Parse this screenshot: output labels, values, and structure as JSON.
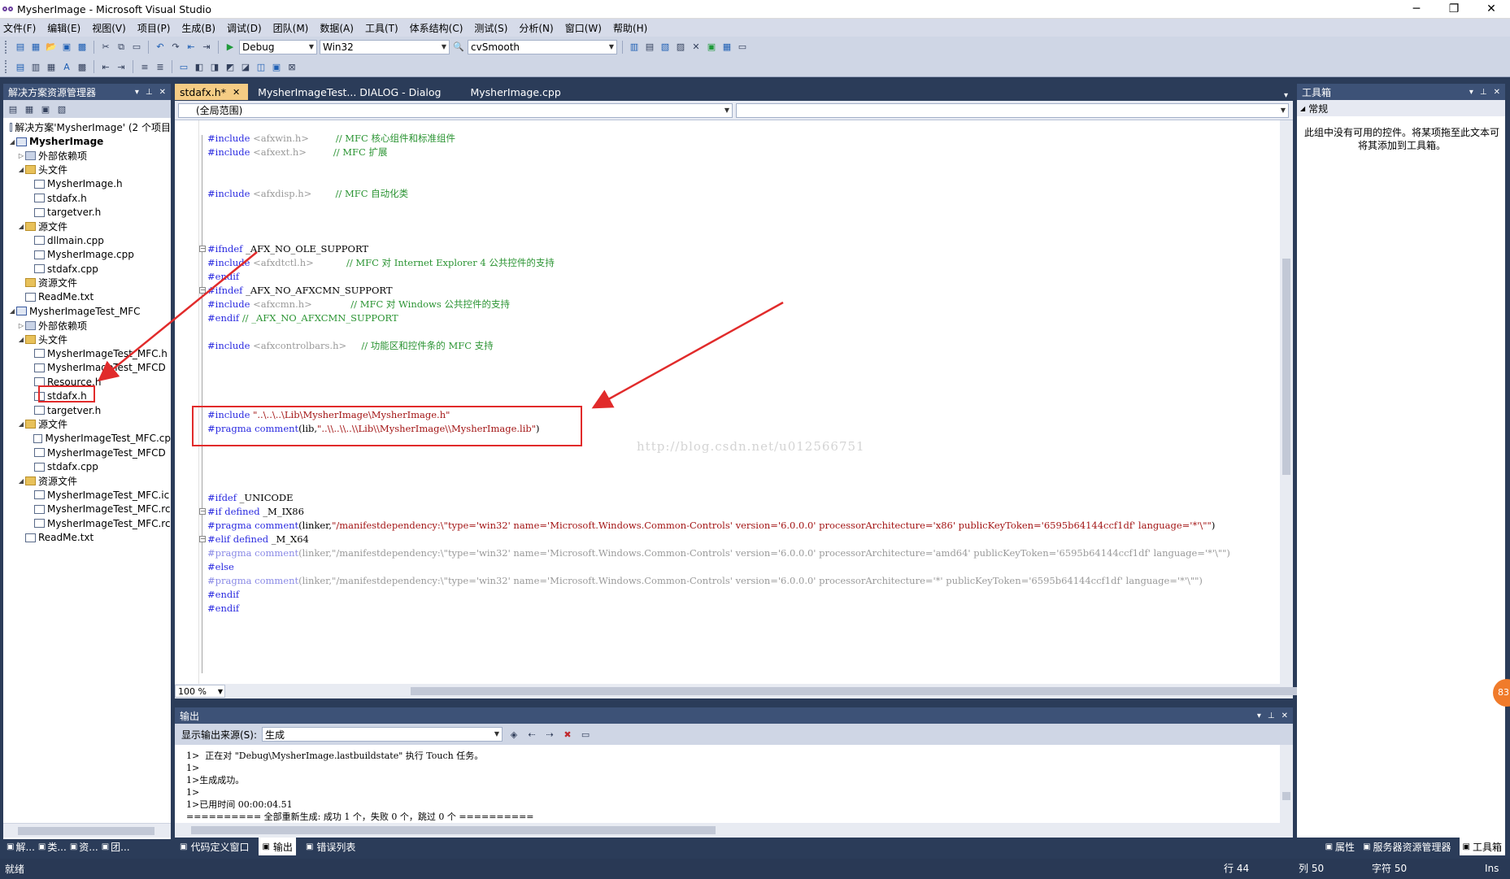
{
  "window": {
    "title": "MysherImage - Microsoft Visual Studio",
    "min": "─",
    "restore": "❐",
    "close": "✕"
  },
  "menu": [
    "文件(F)",
    "编辑(E)",
    "视图(V)",
    "项目(P)",
    "生成(B)",
    "调试(D)",
    "团队(M)",
    "数据(A)",
    "工具(T)",
    "体系结构(C)",
    "测试(S)",
    "分析(N)",
    "窗口(W)",
    "帮助(H)"
  ],
  "toolbar": {
    "config": "Debug",
    "platform": "Win32",
    "find": "cvSmooth"
  },
  "solution": {
    "title": "解决方案资源管理器",
    "items": [
      {
        "label": "解决方案'MysherImage' (2 个项目",
        "indent": 0,
        "icon": "file",
        "exp": ""
      },
      {
        "label": "MysherImage",
        "indent": 0,
        "icon": "proj",
        "exp": "◢",
        "bold": true
      },
      {
        "label": "外部依赖项",
        "indent": 1,
        "icon": "dep",
        "exp": "▷"
      },
      {
        "label": "头文件",
        "indent": 1,
        "icon": "folder",
        "exp": "◢"
      },
      {
        "label": "MysherImage.h",
        "indent": 2,
        "icon": "file",
        "exp": ""
      },
      {
        "label": "stdafx.h",
        "indent": 2,
        "icon": "file",
        "exp": ""
      },
      {
        "label": "targetver.h",
        "indent": 2,
        "icon": "file",
        "exp": ""
      },
      {
        "label": "源文件",
        "indent": 1,
        "icon": "folder",
        "exp": "◢"
      },
      {
        "label": "dllmain.cpp",
        "indent": 2,
        "icon": "file",
        "exp": ""
      },
      {
        "label": "MysherImage.cpp",
        "indent": 2,
        "icon": "file",
        "exp": ""
      },
      {
        "label": "stdafx.cpp",
        "indent": 2,
        "icon": "file",
        "exp": ""
      },
      {
        "label": "资源文件",
        "indent": 1,
        "icon": "folder",
        "exp": ""
      },
      {
        "label": "ReadMe.txt",
        "indent": 1,
        "icon": "file",
        "exp": ""
      },
      {
        "label": "MysherImageTest_MFC",
        "indent": 0,
        "icon": "proj",
        "exp": "◢"
      },
      {
        "label": "外部依赖项",
        "indent": 1,
        "icon": "dep",
        "exp": "▷"
      },
      {
        "label": "头文件",
        "indent": 1,
        "icon": "folder",
        "exp": "◢"
      },
      {
        "label": "MysherImageTest_MFC.h",
        "indent": 2,
        "icon": "file",
        "exp": ""
      },
      {
        "label": "MysherImageTest_MFCD",
        "indent": 2,
        "icon": "file",
        "exp": ""
      },
      {
        "label": "Resource.h",
        "indent": 2,
        "icon": "file",
        "exp": ""
      },
      {
        "label": "stdafx.h",
        "indent": 2,
        "icon": "file",
        "exp": ""
      },
      {
        "label": "targetver.h",
        "indent": 2,
        "icon": "file",
        "exp": ""
      },
      {
        "label": "源文件",
        "indent": 1,
        "icon": "folder",
        "exp": "◢"
      },
      {
        "label": "MysherImageTest_MFC.cp",
        "indent": 2,
        "icon": "file",
        "exp": ""
      },
      {
        "label": "MysherImageTest_MFCD",
        "indent": 2,
        "icon": "file",
        "exp": ""
      },
      {
        "label": "stdafx.cpp",
        "indent": 2,
        "icon": "file",
        "exp": ""
      },
      {
        "label": "资源文件",
        "indent": 1,
        "icon": "folder",
        "exp": "◢"
      },
      {
        "label": "MysherImageTest_MFC.ic",
        "indent": 2,
        "icon": "file",
        "exp": ""
      },
      {
        "label": "MysherImageTest_MFC.rc",
        "indent": 2,
        "icon": "file",
        "exp": ""
      },
      {
        "label": "MysherImageTest_MFC.rc",
        "indent": 2,
        "icon": "file",
        "exp": ""
      },
      {
        "label": "ReadMe.txt",
        "indent": 1,
        "icon": "file",
        "exp": ""
      }
    ],
    "bottom_tabs": [
      "解...",
      "类...",
      "资...",
      "团..."
    ]
  },
  "editor": {
    "tabs": [
      {
        "label": "stdafx.h*",
        "active": true
      },
      {
        "label": "MysherImageTest... DIALOG - Dialog",
        "active": false
      },
      {
        "label": "MysherImage.cpp",
        "active": false
      }
    ],
    "scope": "(全局范围)",
    "zoom": "100 %",
    "lines": [
      {
        "row": 1,
        "parts": [
          [
            "pp",
            "#include "
          ],
          [
            "dimc",
            "<afxwin.h>"
          ],
          [
            "cm",
            "         // MFC 核心组件和标准组件"
          ]
        ]
      },
      {
        "row": 2,
        "parts": [
          [
            "pp",
            "#include "
          ],
          [
            "dimc",
            "<afxext.h>"
          ],
          [
            "cm",
            "         // MFC 扩展"
          ]
        ]
      },
      {
        "row": 5,
        "parts": [
          [
            "pp",
            "#include "
          ],
          [
            "dimc",
            "<afxdisp.h>"
          ],
          [
            "cm",
            "        // MFC 自动化类"
          ]
        ]
      },
      {
        "row": 9,
        "fold": "−",
        "parts": [
          [
            "pp",
            "#ifndef "
          ],
          [
            "",
            "_AFX_NO_OLE_SUPPORT"
          ]
        ]
      },
      {
        "row": 10,
        "parts": [
          [
            "pp",
            "#include "
          ],
          [
            "dimc",
            "<afxdtctl.h>"
          ],
          [
            "cm",
            "           // MFC 对 Internet Explorer 4 公共控件的支持"
          ]
        ]
      },
      {
        "row": 11,
        "parts": [
          [
            "pp",
            "#endif"
          ]
        ]
      },
      {
        "row": 12,
        "fold": "−",
        "parts": [
          [
            "pp",
            "#ifndef "
          ],
          [
            "",
            "_AFX_NO_AFXCMN_SUPPORT"
          ]
        ]
      },
      {
        "row": 13,
        "parts": [
          [
            "pp",
            "#include "
          ],
          [
            "dimc",
            "<afxcmn.h>"
          ],
          [
            "cm",
            "             // MFC 对 Windows 公共控件的支持"
          ]
        ]
      },
      {
        "row": 14,
        "parts": [
          [
            "pp",
            "#endif "
          ],
          [
            "cm",
            "// _AFX_NO_AFXCMN_SUPPORT"
          ]
        ]
      },
      {
        "row": 16,
        "parts": [
          [
            "pp",
            "#include "
          ],
          [
            "dimc",
            "<afxcontrolbars.h>"
          ],
          [
            "cm",
            "     // 功能区和控件条的 MFC 支持"
          ]
        ]
      },
      {
        "row": 21,
        "parts": [
          [
            "pp",
            "#include "
          ],
          [
            "st",
            "\"..\\..\\..\\Lib\\MysherImage\\MysherImage.h\""
          ]
        ]
      },
      {
        "row": 22,
        "parts": [
          [
            "pp",
            "#pragma "
          ],
          [
            "kw",
            "comment"
          ],
          [
            "",
            "(lib,"
          ],
          [
            "st",
            "\"..\\\\..\\\\..\\\\Lib\\\\MysherImage\\\\MysherImage.lib\""
          ],
          [
            "",
            ")"
          ]
        ]
      },
      {
        "row": 27,
        "parts": [
          [
            "pp",
            "#ifdef "
          ],
          [
            "",
            "_UNICODE"
          ]
        ]
      },
      {
        "row": 28,
        "fold": "−",
        "parts": [
          [
            "pp",
            "#if defined "
          ],
          [
            "",
            "_M_IX86"
          ]
        ]
      },
      {
        "row": 29,
        "parts": [
          [
            "pp",
            "#pragma "
          ],
          [
            "kw",
            "comment"
          ],
          [
            "",
            "(linker,"
          ],
          [
            "st",
            "\"/manifestdependency:\\\"type='win32' name='Microsoft.Windows.Common-Controls' version='6.0.0.0' processorArchitecture='x86' publicKeyToken='6595b64144ccf1df' language='*'\\\"\""
          ],
          [
            "",
            ")"
          ]
        ]
      },
      {
        "row": 30,
        "fold": "−",
        "parts": [
          [
            "pp",
            "#elif defined "
          ],
          [
            "",
            "_M_X64"
          ]
        ]
      },
      {
        "row": 31,
        "parts": [
          [
            "dim",
            "#pragma comment"
          ],
          [
            "dimc",
            "(linker,\"/manifestdependency:\\\"type='win32' name='Microsoft.Windows.Common-Controls' version='6.0.0.0' processorArchitecture='amd64' publicKeyToken='6595b64144ccf1df' language='*'\\\"\")"
          ]
        ]
      },
      {
        "row": 32,
        "parts": [
          [
            "pp",
            "#else"
          ]
        ]
      },
      {
        "row": 33,
        "parts": [
          [
            "dim",
            "#pragma comment"
          ],
          [
            "dimc",
            "(linker,\"/manifestdependency:\\\"type='win32' name='Microsoft.Windows.Common-Controls' version='6.0.0.0' processorArchitecture='*' publicKeyToken='6595b64144ccf1df' language='*'\\\"\")"
          ]
        ]
      },
      {
        "row": 34,
        "parts": [
          [
            "pp",
            "#endif"
          ]
        ]
      },
      {
        "row": 35,
        "parts": [
          [
            "pp",
            "#endif"
          ]
        ]
      }
    ],
    "watermark": "http://blog.csdn.net/u012566751"
  },
  "output": {
    "title": "输出",
    "source_label": "显示输出来源(S):",
    "source_value": "生成",
    "lines": [
      "1>  正在对 \"Debug\\MysherImage.lastbuildstate\" 执行 Touch 任务。",
      "1>",
      "1>生成成功。",
      "1>",
      "1>已用时间 00:00:04.51",
      "========== 全部重新生成: 成功 1 个，失败 0 个，跳过 0 个 =========="
    ]
  },
  "bottom_tabs_mid": [
    "代码定义窗口",
    "输出",
    "错误列表"
  ],
  "toolbox": {
    "title": "工具箱",
    "section": "常规",
    "message": "此组中没有可用的控件。将某项拖至此文本可将其添加到工具箱。",
    "bottom_tabs": [
      "属性",
      "服务器资源管理器",
      "工具箱"
    ]
  },
  "status": {
    "text": "就绪",
    "row": "行 44",
    "col": "列 50",
    "char": "字符 50",
    "mode": "Ins"
  },
  "badge": "83"
}
